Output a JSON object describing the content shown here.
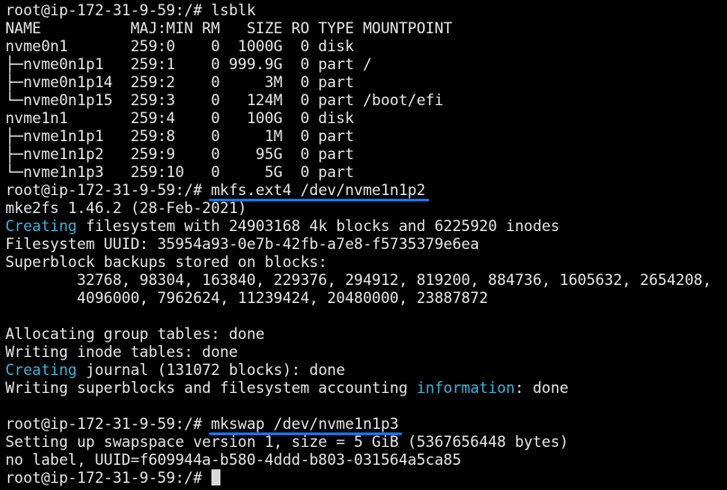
{
  "terminal": {
    "prompt": "root@ip-172-31-9-59:/# ",
    "lines": {
      "l1_cmd": "lsblk",
      "l2": "NAME          MAJ:MIN RM   SIZE RO TYPE MOUNTPOINT",
      "l3": "nvme0n1       259:0    0  1000G  0 disk",
      "l4": "├─nvme0n1p1   259:1    0 999.9G  0 part /",
      "l5": "├─nvme0n1p14  259:2    0     3M  0 part",
      "l6": "└─nvme0n1p15  259:3    0   124M  0 part /boot/efi",
      "l7": "nvme1n1       259:4    0   100G  0 disk",
      "l8": "├─nvme1n1p1   259:8    0     1M  0 part",
      "l9": "├─nvme1n1p2   259:9    0    95G  0 part",
      "l10": "└─nvme1n1p3   259:10   0     5G  0 part",
      "l11_cmd": "mkfs.ext4 /dev/nvme1n1p2",
      "l12": "mke2fs 1.46.2 (28-Feb-2021)",
      "l13_cyan": "Creating",
      "l13_rest": " filesystem with 24903168 4k blocks and 6225920 inodes",
      "l14": "Filesystem UUID: 35954a93-0e7b-42fb-a7e8-f5735379e6ea",
      "l15": "Superblock backups stored on blocks:",
      "l16": "        32768, 98304, 163840, 229376, 294912, 819200, 884736, 1605632, 2654208,",
      "l17": "        4096000, 7962624, 11239424, 20480000, 23887872",
      "l18": "",
      "l19": "Allocating group tables: done",
      "l20": "Writing inode tables: done",
      "l21_cyan": "Creating",
      "l21_rest": " journal (131072 blocks): done",
      "l22_a": "Writing superblocks and filesystem accounting ",
      "l22_cyan": "information",
      "l22_b": ": done",
      "l23": "",
      "l24_cmd": "mkswap /dev/nvme1n1p3",
      "l25": "Setting up swapspace version 1, size = 5 GiB (5367656448 bytes)",
      "l26": "no label, UUID=f609944a-b580-4ddd-b803-031564a5ca85"
    }
  },
  "colors": {
    "background": "#000000",
    "text": "#e8e8e8",
    "highlight_cyan": "#3ab4dc",
    "annotation_underline": "#1a73e8"
  }
}
